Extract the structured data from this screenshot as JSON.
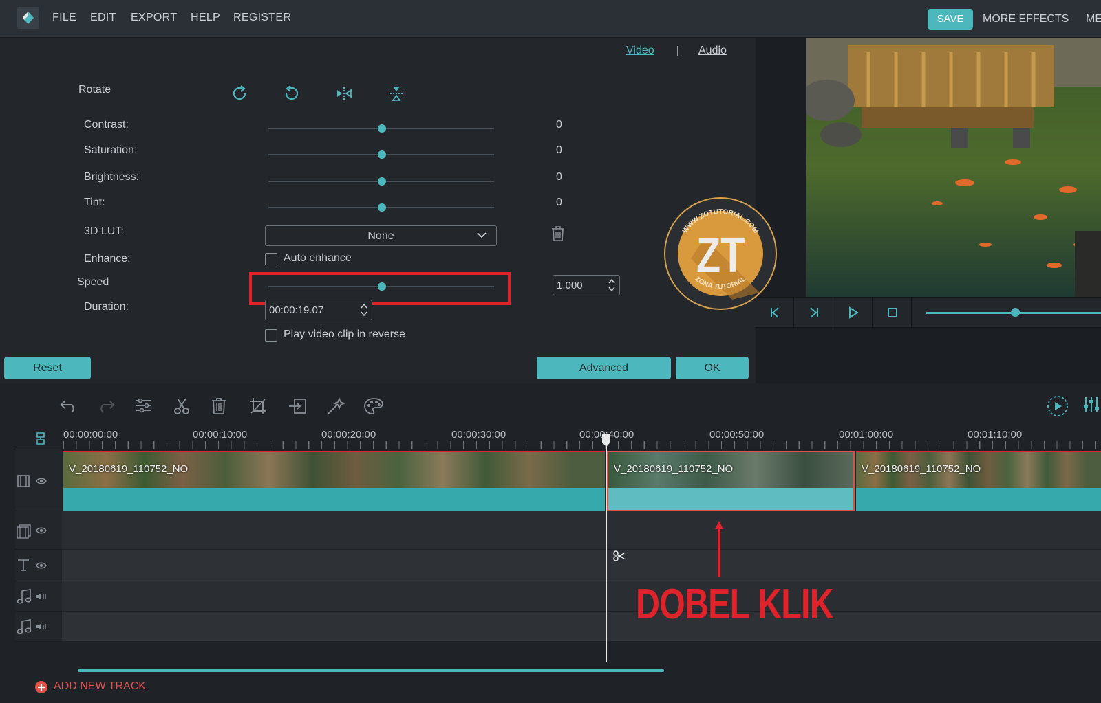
{
  "menu": {
    "items": [
      "FILE",
      "EDIT",
      "EXPORT",
      "HELP",
      "REGISTER"
    ],
    "save": "SAVE",
    "more_effects": "MORE EFFECTS",
    "me": "ME"
  },
  "panel": {
    "tabs": {
      "video": "Video",
      "separator": "|",
      "audio": "Audio"
    },
    "rotate_label": "Rotate",
    "contrast": {
      "label": "Contrast:",
      "value": "0"
    },
    "saturation": {
      "label": "Saturation:",
      "value": "0"
    },
    "brightness": {
      "label": "Brightness:",
      "value": "0"
    },
    "tint": {
      "label": "Tint:",
      "value": "0"
    },
    "lut": {
      "label": "3D LUT:",
      "value": "None"
    },
    "enhance": {
      "label": "Enhance:",
      "checkbox": "Auto enhance"
    },
    "speed": {
      "label": "Speed",
      "value": "1.000"
    },
    "duration": {
      "label": "Duration:",
      "value": "00:00:19.07"
    },
    "reverse": "Play video clip in reverse",
    "reset": "Reset",
    "advanced": "Advanced",
    "ok": "OK"
  },
  "watermark": {
    "top": "WWW.ZOTUTORIAL.COM",
    "mono": "ZT",
    "bottom": "ZONA TUTORIAL"
  },
  "ruler": {
    "labels": [
      "00:00:00:00",
      "00:00:10:00",
      "00:00:20:00",
      "00:00:30:00",
      "00:00:40:00",
      "00:00:50:00",
      "00:01:00:00",
      "00:01:10:00"
    ]
  },
  "clips": [
    {
      "name": "V_20180619_110752_NO"
    },
    {
      "name": "V_20180619_110752_NO"
    },
    {
      "name": "V_20180619_110752_NO"
    }
  ],
  "annotation": "DOBEL KLIK",
  "add_track": "ADD NEW TRACK",
  "colors": {
    "accent": "#4cb8bd",
    "annotation_red": "#e0232b"
  }
}
